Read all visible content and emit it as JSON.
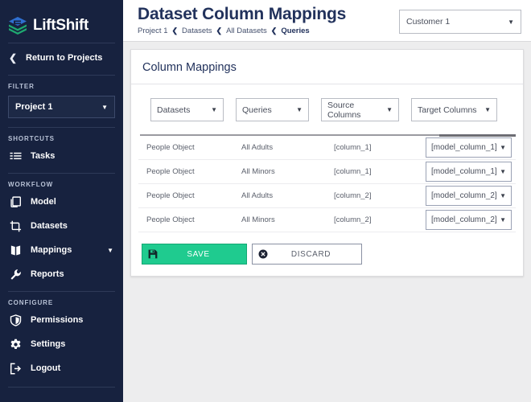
{
  "brand": {
    "name": "LiftShift",
    "logo_icon": "layers-icon",
    "logo_blue": "#2f6fd0",
    "logo_green": "#1fa971"
  },
  "sidebar": {
    "back": {
      "label": "Return to Projects",
      "icon": "chevron-left-icon"
    },
    "filter_section": "FILTER",
    "project_select": {
      "value": "Project 1",
      "icon": "chevron-down-icon"
    },
    "shortcuts_section": "SHORTCUTS",
    "shortcuts": [
      {
        "label": "Tasks",
        "icon": "list-icon"
      }
    ],
    "workflow_section": "WORKFLOW",
    "workflow": [
      {
        "label": "Model",
        "icon": "copy-icon",
        "caret": false
      },
      {
        "label": "Datasets",
        "icon": "crop-icon",
        "caret": false
      },
      {
        "label": "Mappings",
        "icon": "book-icon",
        "caret": true
      },
      {
        "label": "Reports",
        "icon": "wrench-icon",
        "caret": false
      }
    ],
    "configure_section": "CONFIGURE",
    "configure": [
      {
        "label": "Permissions",
        "icon": "shield-icon"
      },
      {
        "label": "Settings",
        "icon": "gear-icon"
      },
      {
        "label": "Logout",
        "icon": "logout-icon"
      }
    ]
  },
  "header": {
    "title": "Dataset Column Mappings",
    "breadcrumb": [
      "Project 1",
      "Datasets",
      "All Datasets",
      "Queries"
    ],
    "breadcrumb_separator": "❮",
    "customer_select": {
      "value": "Customer 1",
      "icon": "chevron-down-icon"
    }
  },
  "card": {
    "title": "Column Mappings",
    "filters": [
      {
        "label": "Datasets",
        "icon": "chevron-down-icon"
      },
      {
        "label": "Queries",
        "icon": "chevron-down-icon"
      },
      {
        "label": "Source Columns",
        "icon": "chevron-down-icon"
      },
      {
        "label": "Target Columns",
        "icon": "chevron-down-icon"
      }
    ],
    "rows": [
      {
        "dataset": "People Object",
        "query": "All Adults",
        "source": "[column_1]",
        "target": "[model_column_1]"
      },
      {
        "dataset": "People Object",
        "query": "All Minors",
        "source": "[column_1]",
        "target": "[model_column_1]"
      },
      {
        "dataset": "People Object",
        "query": "All Adults",
        "source": "[column_2]",
        "target": "[model_column_2]"
      },
      {
        "dataset": "People Object",
        "query": "All Minors",
        "source": "[column_2]",
        "target": "[model_column_2]"
      }
    ],
    "actions": {
      "save": {
        "label": "SAVE",
        "icon": "floppy-disk-icon",
        "color": "#1fcb8f"
      },
      "discard": {
        "label": "DISCARD",
        "icon": "x-circle-icon"
      }
    }
  }
}
